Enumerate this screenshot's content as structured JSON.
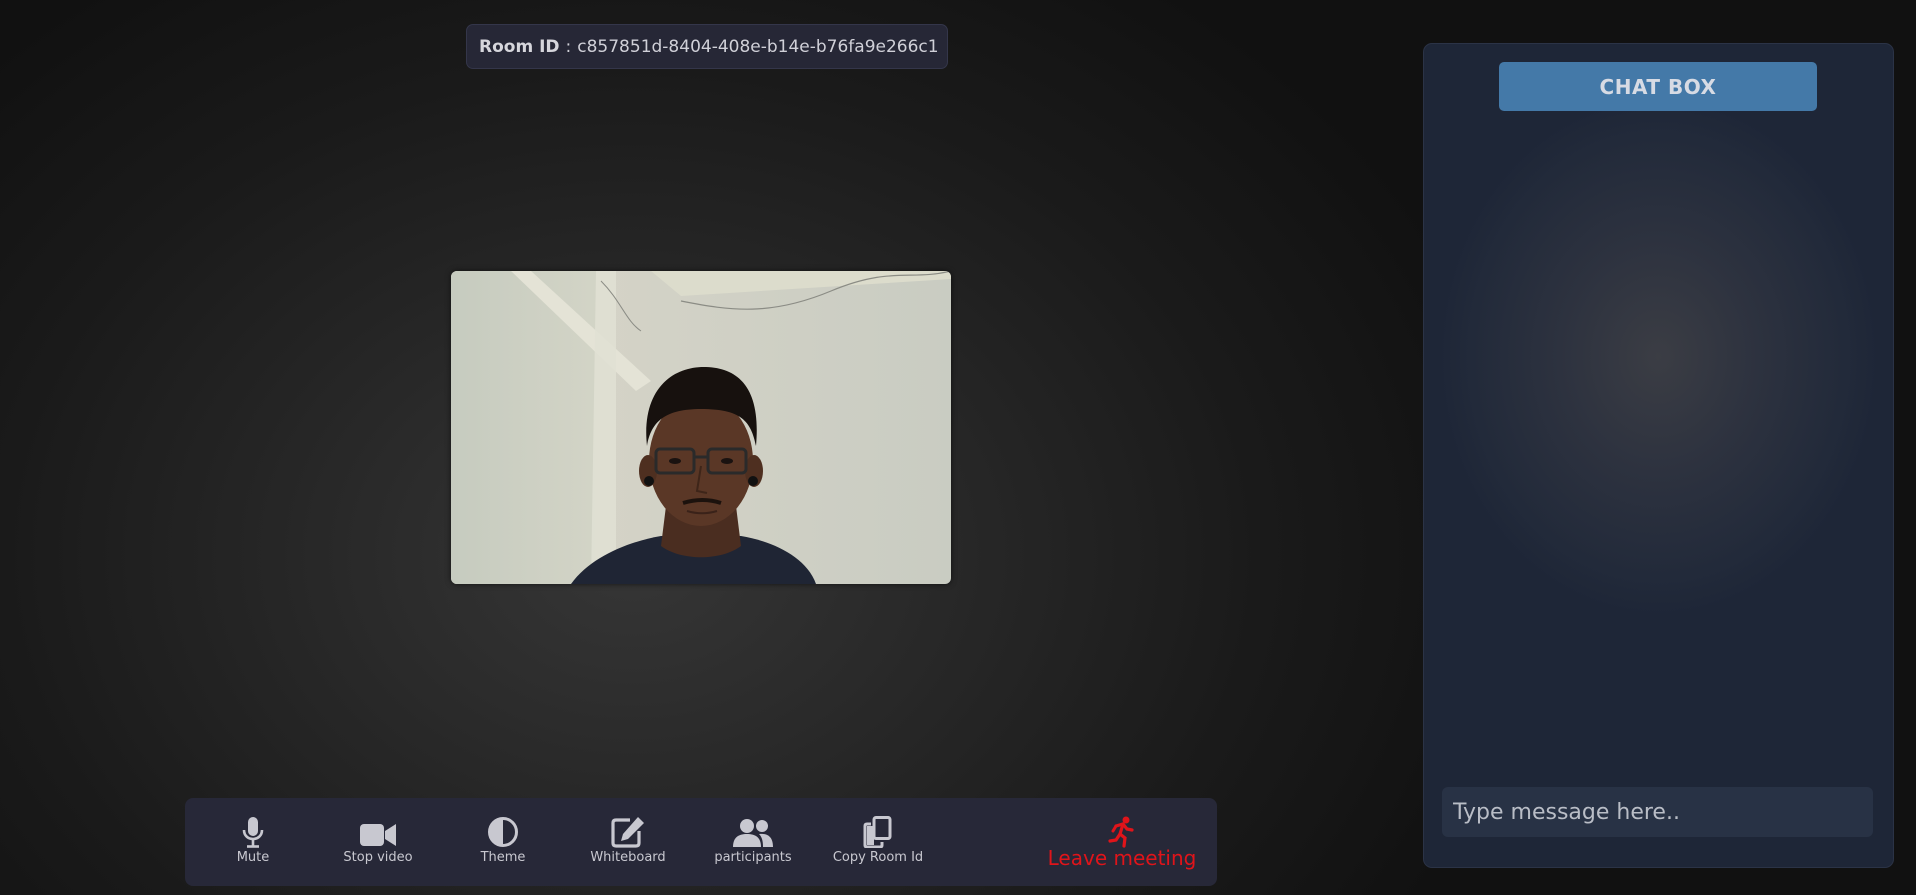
{
  "room": {
    "label": "Room ID",
    "separator": ":",
    "value": "c857851d-8404-408e-b14e-b76fa9e266c1"
  },
  "video": {
    "participant_icon": "webcam-feed"
  },
  "toolbar": {
    "mute": {
      "label": "Mute",
      "icon": "microphone-icon"
    },
    "stop_video": {
      "label": "Stop video",
      "icon": "video-camera-icon"
    },
    "theme": {
      "label": "Theme",
      "icon": "half-circle-contrast-icon"
    },
    "whiteboard": {
      "label": "Whiteboard",
      "icon": "pen-square-icon"
    },
    "participants": {
      "label": "participants",
      "icon": "users-icon"
    },
    "copy_room_id": {
      "label": "Copy Room Id",
      "icon": "copy-icon"
    },
    "leave": {
      "label": "Leave meeting",
      "icon": "running-person-icon",
      "color": "#e0141a"
    }
  },
  "chat": {
    "title": "CHAT BOX",
    "input_placeholder": "Type message here..",
    "input_value": "",
    "title_color": "#4479a8"
  }
}
